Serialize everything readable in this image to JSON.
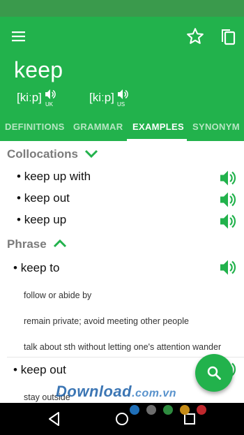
{
  "app_bar": {
    "headword": "keep",
    "pronunciations": [
      {
        "ipa": "[kiːp]",
        "region": "UK"
      },
      {
        "ipa": "[kiːp]",
        "region": "US"
      }
    ],
    "icons": {
      "menu": "menu-icon",
      "favorite": "star-outline-icon",
      "copy": "copy-icon"
    }
  },
  "tabs": [
    {
      "label": "DEFINITIONS",
      "active": false
    },
    {
      "label": "GRAMMAR",
      "active": false
    },
    {
      "label": "EXAMPLES",
      "active": true
    },
    {
      "label": "SYNONYM",
      "active": false
    }
  ],
  "collocations": {
    "title": "Collocations",
    "expanded": false,
    "items": [
      "keep up with",
      "keep out",
      "keep up"
    ]
  },
  "phrase": {
    "title": "Phrase",
    "expanded": true,
    "items": [
      {
        "term": "keep to",
        "definitions": [
          "follow or abide by",
          "remain private; avoid meeting other people",
          "talk about sth without letting one's attention wander"
        ]
      },
      {
        "term": "keep out",
        "definitions": [
          "stay outside"
        ]
      }
    ]
  },
  "fab": {
    "icon": "search-icon"
  },
  "watermark": {
    "text": "Download",
    "suffix": ".com.vn"
  },
  "watermark_dots": [
    "#1f6fb8",
    "#6d6d6d",
    "#2e8b3f",
    "#c58b16",
    "#c0282d"
  ],
  "nav_bar": {
    "icons": [
      "back-icon",
      "home-icon",
      "recents-icon"
    ]
  },
  "colors": {
    "accent": "#22b24c",
    "status_bar": "#3a9a4c",
    "section_header": "#7b7b7b"
  }
}
